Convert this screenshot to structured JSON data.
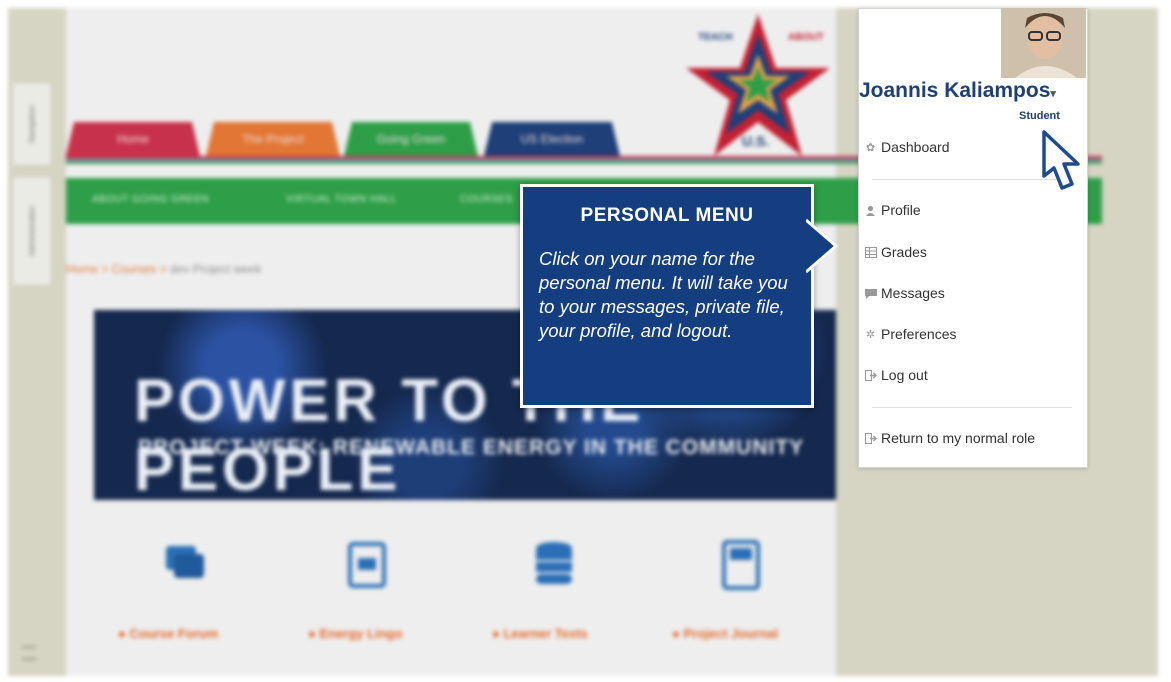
{
  "background": {
    "tabs": [
      "Home",
      "The Project",
      "Going Green",
      "US Election"
    ],
    "nav_items": [
      "ABOUT GOING GREEN",
      "VIRTUAL TOWN HALL",
      "COURSES"
    ],
    "breadcrumb": {
      "home": "Home",
      "courses": "Courses",
      "current": "dev Project week"
    },
    "banner_title": "POWER TO THE PEOPLE",
    "banner_subtitle": "PROJECT WEEK: RENEWABLE ENERGY IN THE COMMUNITY",
    "logo": {
      "left": "TEACH",
      "right": "ABOUT",
      "bottom": "U.S."
    },
    "side_tabs": [
      "Navigation",
      "Administration"
    ],
    "activities": [
      "Course Forum",
      "Energy Lingo",
      "Learner Texts",
      "Project Journal"
    ]
  },
  "callout": {
    "title": "PERSONAL MENU",
    "text": "Click on your name for the personal menu. It will take you to your messages, private file, your profile, and logout."
  },
  "user_menu": {
    "name": "Joannis Kaliampos",
    "role": "Student",
    "items": [
      {
        "label": "Dashboard",
        "icon": "dashboard-icon"
      },
      {
        "label": "Profile",
        "icon": "user-icon"
      },
      {
        "label": "Grades",
        "icon": "grades-icon"
      },
      {
        "label": "Messages",
        "icon": "messages-icon"
      },
      {
        "label": "Preferences",
        "icon": "gear-icon"
      },
      {
        "label": "Log out",
        "icon": "logout-icon"
      },
      {
        "label": "Return to my normal role",
        "icon": "return-icon"
      }
    ]
  },
  "colors": {
    "callout_bg": "#143e80",
    "name_color": "#1e3f77",
    "tab_home": "#c8314b",
    "tab_project": "#e27634",
    "tab_green": "#2e9e48",
    "tab_election": "#1e3f77",
    "nav_green": "#2e9e48",
    "activity_orange": "#e2692c"
  }
}
